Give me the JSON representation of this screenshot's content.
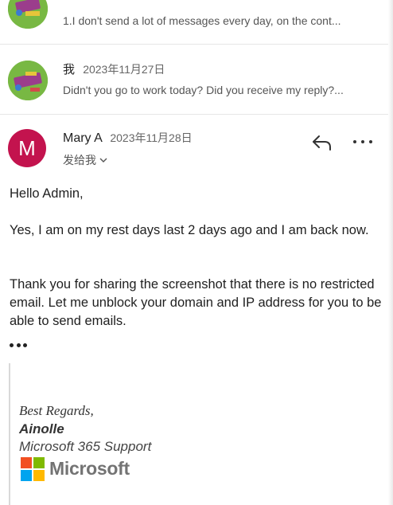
{
  "thread": [
    {
      "sender": "",
      "date": "",
      "snippet": "1.I don't send a lot of messages every day, on the cont..."
    },
    {
      "sender": "我",
      "date": "2023年11月27日",
      "snippet": "Didn't you go to work today? Did you receive my reply?..."
    }
  ],
  "message": {
    "avatar_initial": "M",
    "sender": "Mary A",
    "date": "2023年11月28日",
    "recipient": "发给我",
    "paragraphs": [
      "Hello Admin,",
      "Yes, I am on my rest days last 2 days ago and I am back now.",
      "Thank you for sharing the screenshot that there is no restricted email. Let me unblock your domain and IP address for you to be able to send emails."
    ]
  },
  "signature": {
    "regards": "Best Regards,",
    "name": "Ainolle",
    "role": "Microsoft 365 Support",
    "logo_text": "Microsoft",
    "logo_colors": [
      "#f25022",
      "#7fba00",
      "#00a4ef",
      "#ffb900"
    ]
  },
  "colors": {
    "avatar_m": "#c3134e",
    "avatar_img": "#78b843"
  },
  "icons": {
    "reply": "reply-arrow-icon",
    "more": "more-horizontal-icon",
    "chevron": "chevron-down-icon"
  }
}
